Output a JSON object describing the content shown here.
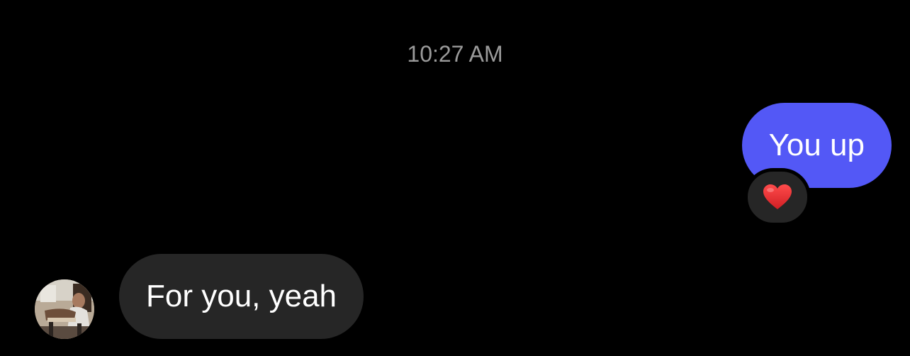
{
  "conversation": {
    "timestamp": "10:27 AM",
    "messages": [
      {
        "direction": "outgoing",
        "text": "You up",
        "reaction": "heart-icon"
      },
      {
        "direction": "incoming",
        "text": "For you, yeah",
        "sender_avatar": "avatar"
      }
    ]
  },
  "colors": {
    "background": "#000000",
    "outgoing_bubble": "#5358f6",
    "incoming_bubble": "#262626",
    "timestamp_text": "#9a9a9a",
    "reaction_heart": "#e8262b"
  }
}
